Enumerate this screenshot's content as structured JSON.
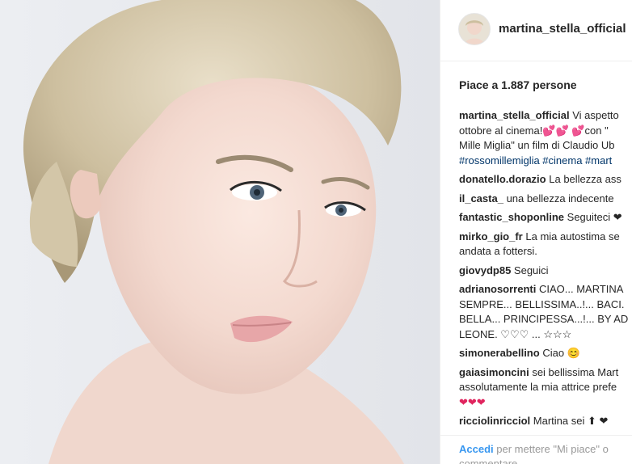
{
  "post": {
    "username": "martina_stella_official",
    "likes_text": "Piace a 1.887 persone"
  },
  "caption": {
    "username": "martina_stella_official",
    "text_line1": "Vi aspetto",
    "text_line2": "ottobre al cinema!💕💕 💕con \"",
    "text_line3": "Mille Miglia\" un film di Claudio Ub",
    "hashtags": "#rossomillemiglia #cinema #mart"
  },
  "comments": [
    {
      "user": "donatello.dorazio",
      "text": "La bellezza ass"
    },
    {
      "user": "il_casta_",
      "text": "una bellezza indecente"
    },
    {
      "user": "fantastic_shoponline",
      "text": "Seguiteci ❤"
    },
    {
      "user": "mirko_gio_fr",
      "text": "La mia autostima se",
      "text2": "andata a fottersi."
    },
    {
      "user": "giovydp85",
      "text": "Seguici"
    },
    {
      "user": "adrianosorrenti",
      "text": "CIAO... MARTINA",
      "text2": "SEMPRE... BELLISSIMA..!... BACI.",
      "text3": "BELLA... PRINCIPESSA...!... BY AD",
      "text4": "LEONE. ♡♡♡ ... ☆☆☆"
    },
    {
      "user": "simonerabellino",
      "text": "Ciao 😊"
    },
    {
      "user": "gaiasimoncini",
      "text": "sei bellissima Mart",
      "text2": "assolutamente la mia attrice prefe",
      "text3": "❤❤❤"
    },
    {
      "user": "ricciolinricciol",
      "text": "Martina sei ⬆ ❤"
    }
  ],
  "footer": {
    "login_link": "Accedi",
    "login_text": "per mettere \"Mi piace\" o",
    "login_text2": "commentare."
  },
  "colors": {
    "link": "#3897f0",
    "hashtag": "#003569",
    "text": "#262626",
    "muted": "#999999"
  }
}
